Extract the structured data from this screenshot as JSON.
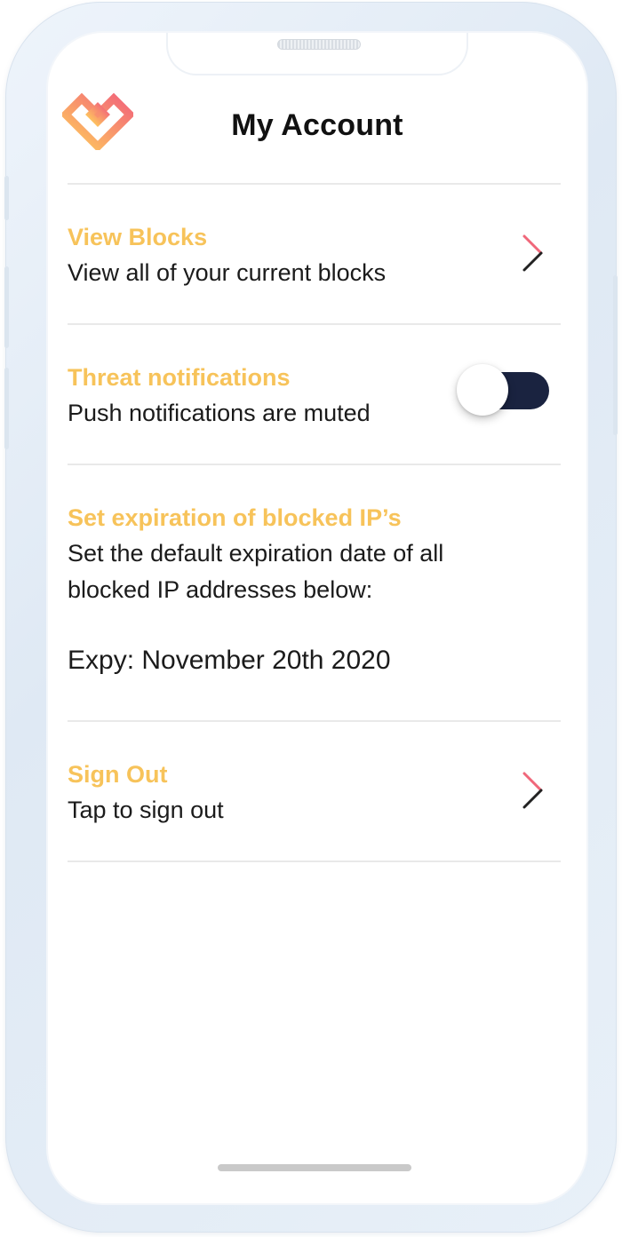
{
  "header": {
    "title": "My Account",
    "logo_icon": "brand-heart-logo-icon"
  },
  "rows": {
    "view_blocks": {
      "title": "View Blocks",
      "subtitle": "View all of your current blocks"
    },
    "threat_notifications": {
      "title": "Threat notifications",
      "subtitle": "Push notifications are muted",
      "toggle_on": false
    },
    "expiration": {
      "title": "Set expiration of blocked IP’s",
      "subtitle_line1": "Set the default expiration date of all",
      "subtitle_line2": "blocked IP addresses below:",
      "expy": "Expy: November 20th 2020"
    },
    "sign_out": {
      "title": "Sign Out",
      "subtitle": "Tap to sign out"
    }
  },
  "colors": {
    "accent_title": "#f7c35a",
    "toggle_track": "#1a2340",
    "chevron_top": "#f0677a",
    "chevron_bottom": "#222222",
    "logo_gradient_start": "#ffcd5c",
    "logo_gradient_end": "#f2657a"
  }
}
